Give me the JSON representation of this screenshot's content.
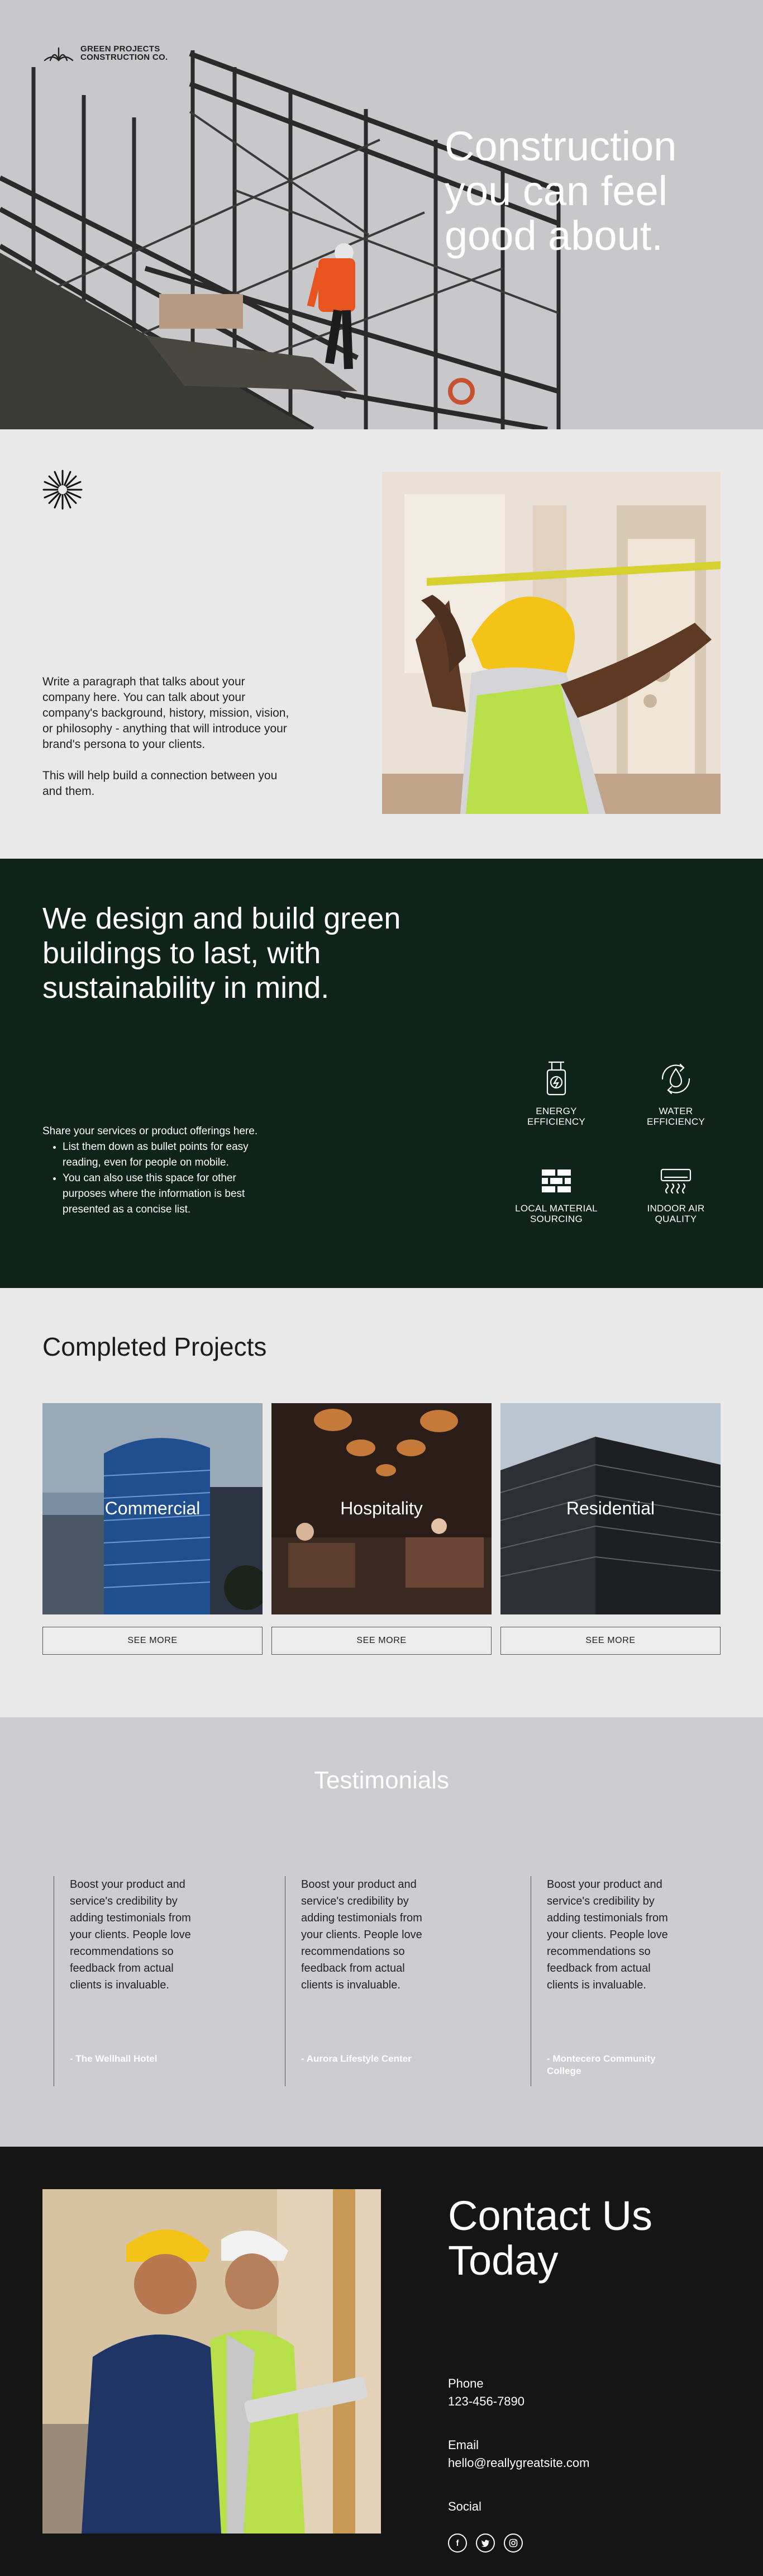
{
  "brand": {
    "name_line1": "GREEN PROJECTS",
    "name_line2": "CONSTRUCTION CO."
  },
  "hero": {
    "title": "Construction you can feel good about."
  },
  "about": {
    "paragraph1": "Write a paragraph that talks about your company here. You can talk about your company's background, history, mission, vision, or philosophy - anything that will introduce your brand's persona to your clients.",
    "paragraph2": "This will help build a connection between you and them."
  },
  "services": {
    "heading": "We design and build green buildings to last, with sustainability in mind.",
    "intro": "Share your services or product offerings here.",
    "bullets": [
      "List them down as bullet points for easy reading, even for people on mobile.",
      "You can also use this space for other purposes where the information is best presented as a concise list."
    ],
    "features": [
      {
        "icon": "energy-efficiency-icon",
        "line1": "ENERGY",
        "line2": "EFFICIENCY"
      },
      {
        "icon": "water-efficiency-icon",
        "line1": "WATER",
        "line2": "EFFICIENCY"
      },
      {
        "icon": "local-material-sourcing-icon",
        "line1": "LOCAL MATERIAL",
        "line2": "SOURCING"
      },
      {
        "icon": "indoor-air-quality-icon",
        "line1": "INDOOR AIR",
        "line2": "QUALITY"
      }
    ]
  },
  "projects": {
    "heading": "Completed Projects",
    "cards": [
      {
        "label": "Commercial",
        "button": "SEE MORE"
      },
      {
        "label": "Hospitality",
        "button": "SEE MORE"
      },
      {
        "label": "Residential",
        "button": "SEE MORE"
      }
    ]
  },
  "testimonials": {
    "heading": "Testimonials",
    "items": [
      {
        "text": "Boost your product and service's credibility by adding testimonials from your clients. People love recommendations so feedback from actual clients is invaluable.",
        "author": "- The Wellhall Hotel"
      },
      {
        "text": "Boost your product and service's credibility by adding testimonials from your clients. People love recommendations so feedback from actual clients is invaluable.",
        "author": "- Aurora Lifestyle Center"
      },
      {
        "text": "Boost your product and service's credibility by adding testimonials from your clients. People love recommendations so feedback from actual clients is invaluable.",
        "author": "- Montecero Community College"
      }
    ]
  },
  "contact": {
    "heading": "Contact Us Today",
    "phone_label": "Phone",
    "phone": "123-456-7890",
    "email_label": "Email",
    "email": "hello@reallygreatsite.com",
    "social_label": "Social",
    "social_icons": [
      "facebook-icon",
      "twitter-icon",
      "instagram-icon"
    ]
  },
  "colors": {
    "services_bg": "#0e241b",
    "page_light": "#e9e9e9",
    "testimonials_bg": "#ccccd1",
    "contact_bg": "#151515",
    "accent_orange": "#e8541f",
    "hard_hat_yellow": "#f3c317"
  }
}
